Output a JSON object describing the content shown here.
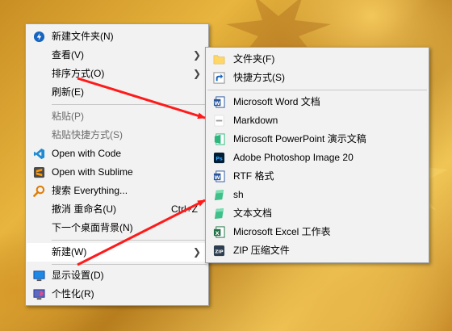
{
  "context_menu": {
    "items": [
      {
        "label": "新建文件夹(N)",
        "icon": "new-folder-icon"
      },
      {
        "label": "查看(V)"
      },
      {
        "label": "排序方式(O)"
      },
      {
        "label": "刷新(E)"
      },
      {
        "label": "粘贴(P)"
      },
      {
        "label": "粘贴快捷方式(S)"
      },
      {
        "label": "Open with Code",
        "icon": "vscode-icon"
      },
      {
        "label": "Open with Sublime",
        "icon": "sublime-icon"
      },
      {
        "label": "搜索 Everything...",
        "icon": "everything-search-icon"
      },
      {
        "label": "撤消 重命名(U)",
        "accel": "Ctrl+Z"
      },
      {
        "label": "下一个桌面背景(N)"
      },
      {
        "label": "新建(W)"
      },
      {
        "label": "显示设置(D)",
        "icon": "display-icon"
      },
      {
        "label": "个性化(R)",
        "icon": "personalize-icon"
      }
    ]
  },
  "submenu_new": {
    "items": [
      {
        "label": "文件夹(F)",
        "icon": "folder-icon"
      },
      {
        "label": "快捷方式(S)",
        "icon": "shortcut-icon"
      },
      {
        "label": "Microsoft Word 文档",
        "icon": "word-icon"
      },
      {
        "label": "Markdown",
        "icon": "markdown-icon"
      },
      {
        "label": "Microsoft PowerPoint 演示文稿",
        "icon": "powerpoint-icon"
      },
      {
        "label": "Adobe Photoshop Image 20",
        "icon": "photoshop-icon"
      },
      {
        "label": "RTF 格式",
        "icon": "rtf-icon"
      },
      {
        "label": "sh",
        "icon": "sh-file-icon"
      },
      {
        "label": "文本文档",
        "icon": "text-file-icon"
      },
      {
        "label": "Microsoft Excel 工作表",
        "icon": "excel-icon"
      },
      {
        "label": "ZIP 压缩文件",
        "icon": "zip-icon"
      }
    ]
  },
  "colors": {
    "annotation_arrow": "#ff1a1a",
    "menu_bg": "#f2f2f2",
    "highlight": "#ffffff"
  }
}
